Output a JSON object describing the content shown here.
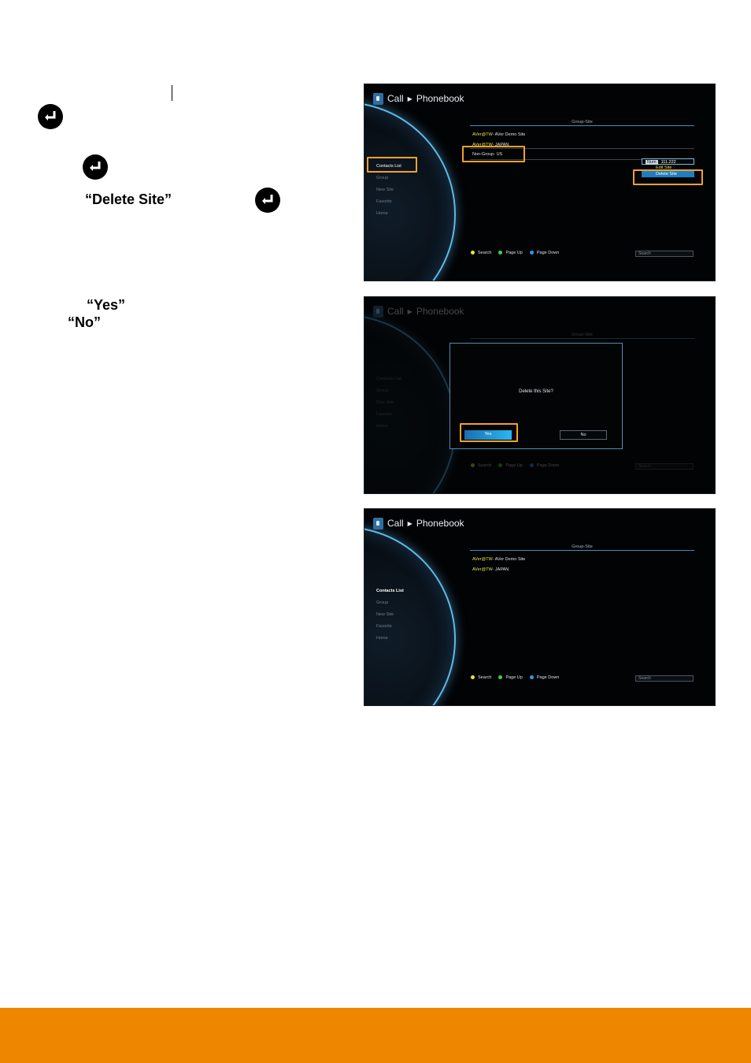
{
  "instructions": {
    "delete_site_quoted": "“Delete Site”",
    "yes_quoted": "“Yes”",
    "no_quoted": "“No”"
  },
  "icons": {
    "enter_key": "enter-key-icon",
    "book": "phonebook-icon"
  },
  "screen": {
    "breadcrumb_root": "Call",
    "breadcrumb_arrow": "▶",
    "breadcrumb_page": "Phonebook",
    "column_header": "Group-Site",
    "menu": [
      "Contacts List",
      "Group",
      "New Site",
      "Favorite",
      "Home"
    ],
    "footer": {
      "search": "Search",
      "page_up": "Page Up",
      "page_down": "Page Down",
      "search_box": "Search"
    }
  },
  "screen1": {
    "rows": [
      {
        "group": "AVer@TW-",
        "site": " AVer Demo Site"
      },
      {
        "group": "AVer@TW-",
        "site": " JAPAN"
      },
      {
        "group": "",
        "site": "Non-Group- US"
      }
    ],
    "context_menu": {
      "number_tag": "Num",
      "number_value": "111.222",
      "edit_site": "Edit Site",
      "delete_site": "Delete Site"
    }
  },
  "screen2": {
    "dialog_message": "Delete this Site?",
    "yes_label": "Yes",
    "no_label": "No"
  },
  "screen3": {
    "rows": [
      {
        "group": "AVer@TW-",
        "site": " AVer Demo Site"
      },
      {
        "group": "AVer@TW-",
        "site": " JAPAN"
      }
    ]
  },
  "colors": {
    "highlight": "#f0a12e",
    "footer_bar": "#ee8600",
    "dot_yellow": "#e9e23a",
    "dot_green": "#3fd23f",
    "dot_blue": "#2a9ce8"
  }
}
